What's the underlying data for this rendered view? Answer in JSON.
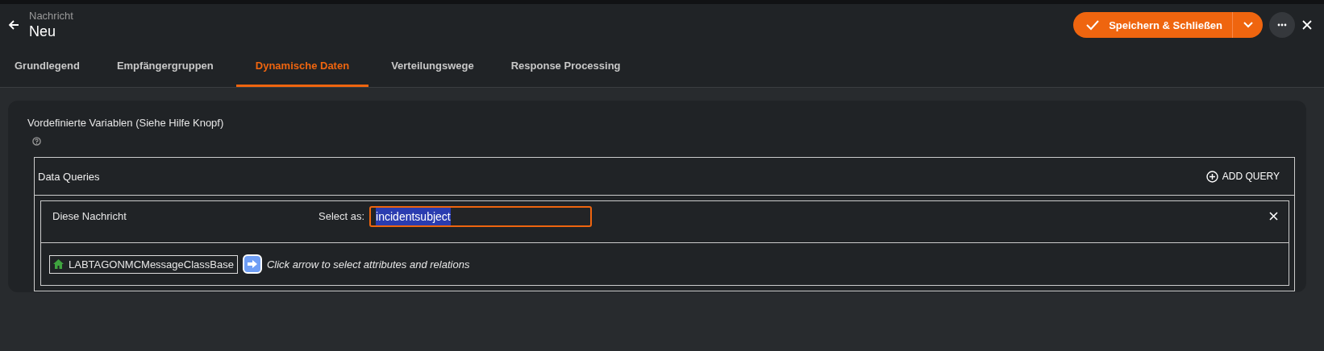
{
  "header": {
    "subtitle": "Nachricht",
    "title": "Neu"
  },
  "actions": {
    "save_label": "Speichern & Schließen"
  },
  "tabs": [
    {
      "label": "Grundlegend",
      "selected": false
    },
    {
      "label": "Empfängergruppen",
      "selected": false
    },
    {
      "label": "Dynamische Daten",
      "selected": true
    },
    {
      "label": "Verteilungswege",
      "selected": false
    },
    {
      "label": "Response Processing",
      "selected": false
    }
  ],
  "section": {
    "label": "Vordefinierte Variablen (Siehe Hilfe Knopf)"
  },
  "queries": {
    "title": "Data Queries",
    "add_label": "ADD QUERY",
    "items": [
      {
        "name": "Diese Nachricht",
        "select_label": "Select as:",
        "value": "incidentsubject",
        "root": "LABTAGONMCMessageClassBase",
        "hint": "Click arrow to select attributes and relations"
      }
    ]
  }
}
